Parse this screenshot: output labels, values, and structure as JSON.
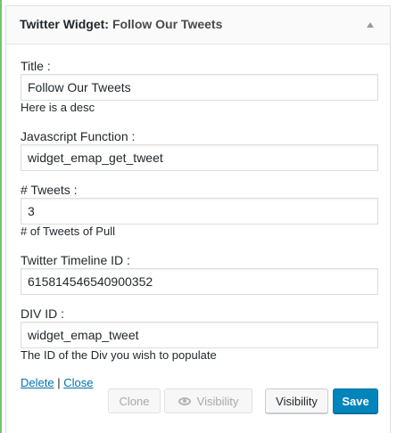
{
  "widget": {
    "title": "Twitter Widget:",
    "subtitle": "Follow Our Tweets"
  },
  "fields": [
    {
      "label": "Title :",
      "value": "Follow Our Tweets",
      "description": "Here is a desc"
    },
    {
      "label": "Javascript Function :",
      "value": "widget_emap_get_tweet",
      "description": ""
    },
    {
      "label": "# Tweets :",
      "value": "3",
      "description": "# of Tweets of Pull"
    },
    {
      "label": "Twitter Timeline ID :",
      "value": "615814546540900352",
      "description": ""
    },
    {
      "label": "DIV ID :",
      "value": "widget_emap_tweet",
      "description": "The ID of the Div you wish to populate"
    }
  ],
  "links": {
    "delete": "Delete",
    "separator": " | ",
    "close": "Close"
  },
  "buttons": {
    "clone": "Clone",
    "visibility_disabled": "Visibility",
    "visibility": "Visibility",
    "save": "Save"
  },
  "icons": {
    "toggle": "arrow-up-icon",
    "visibility": "eye-icon"
  },
  "colors": {
    "primary": "#0085ba",
    "link": "#0073aa",
    "active_border": "#6fc46f"
  }
}
